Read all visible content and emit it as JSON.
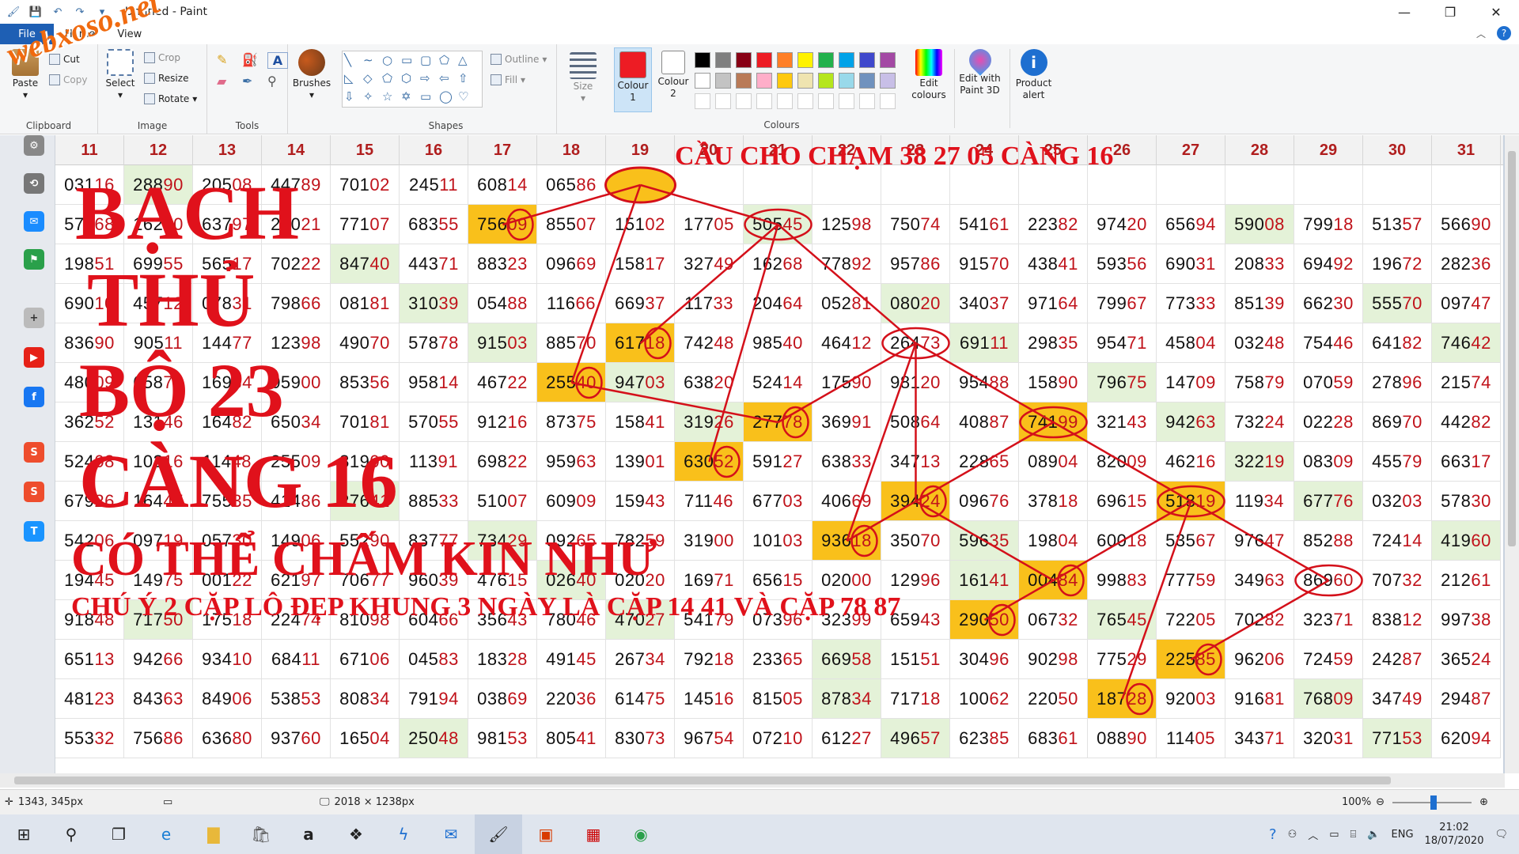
{
  "window": {
    "title": "Untitled - Paint"
  },
  "menu": {
    "file": "File",
    "tabs": [
      "Home",
      "View"
    ],
    "help": "?"
  },
  "ribbon": {
    "clipboard": {
      "label": "Clipboard",
      "paste": "Paste",
      "cut": "Cut",
      "copy": "Copy"
    },
    "image": {
      "label": "Image",
      "select": "Select",
      "crop": "Crop",
      "resize": "Resize",
      "rotate": "Rotate"
    },
    "tools": {
      "label": "Tools"
    },
    "brushes": {
      "label": "Brushes"
    },
    "shapes": {
      "label": "Shapes",
      "outline": "Outline",
      "fill": "Fill"
    },
    "size": {
      "label": "Size"
    },
    "colour1": {
      "line1": "Colour",
      "line2": "1"
    },
    "colour2": {
      "line1": "Colour",
      "line2": "2"
    },
    "colours": {
      "label": "Colours"
    },
    "edit_colours": {
      "line1": "Edit",
      "line2": "colours"
    },
    "edit_3d": {
      "line1": "Edit with",
      "line2": "Paint 3D"
    },
    "product_alert": {
      "line1": "Product",
      "line2": "alert"
    },
    "palette_row1": [
      "#000000",
      "#7f7f7f",
      "#880015",
      "#ed1c24",
      "#ff7f27",
      "#fff200",
      "#22b14c",
      "#00a2e8",
      "#3f48cc",
      "#a349a4"
    ],
    "palette_row2": [
      "#ffffff",
      "#c3c3c3",
      "#b97a57",
      "#ffaec9",
      "#ffc90e",
      "#efe4b0",
      "#b5e61d",
      "#99d9ea",
      "#7092be",
      "#c8bfe7"
    ],
    "colour1_hex": "#ed1c24",
    "colour2_hex": "#ffffff"
  },
  "watermark": "webxoso.net",
  "table": {
    "headers": [
      "11",
      "12",
      "13",
      "14",
      "15",
      "16",
      "17",
      "18",
      "19",
      "20",
      "21",
      "22",
      "23",
      "24",
      "25",
      "26",
      "27",
      "28",
      "29",
      "30",
      "31"
    ],
    "rows": [
      [
        "03116",
        "28890",
        "20508",
        "44789",
        "70102",
        "24511",
        "60814",
        "06586",
        "",
        "",
        "",
        "",
        "",
        "",
        "",
        "",
        "",
        "",
        "",
        "",
        ""
      ],
      [
        "57168",
        "16280",
        "63797",
        "22021",
        "77107",
        "68355",
        "75609",
        "85507",
        "15102",
        "17705",
        "50545",
        "12598",
        "75074",
        "54161",
        "22382",
        "97420",
        "65694",
        "59008",
        "79918",
        "51357",
        "56690"
      ],
      [
        "19851",
        "69955",
        "56517",
        "70222",
        "84740",
        "44371",
        "88323",
        "09669",
        "15817",
        "32749",
        "16268",
        "77892",
        "95786",
        "91570",
        "43841",
        "59356",
        "69031",
        "20833",
        "69492",
        "19672",
        "28236"
      ],
      [
        "69010",
        "45712",
        "07831",
        "79866",
        "08181",
        "31039",
        "05488",
        "11666",
        "66937",
        "11733",
        "20464",
        "05281",
        "08020",
        "34037",
        "97164",
        "79967",
        "77333",
        "85139",
        "66230",
        "55570",
        "09747"
      ],
      [
        "83690",
        "90511",
        "14477",
        "12398",
        "49070",
        "57878",
        "91503",
        "88570",
        "61718",
        "74248",
        "98540",
        "46412",
        "26473",
        "69111",
        "29835",
        "95471",
        "45804",
        "03248",
        "75446",
        "64182",
        "74642"
      ],
      [
        "48009",
        "65874",
        "16984",
        "05900",
        "85356",
        "95814",
        "46722",
        "25540",
        "94703",
        "63820",
        "52414",
        "17590",
        "98120",
        "95488",
        "15890",
        "79675",
        "14709",
        "75879",
        "07059",
        "27896",
        "21574"
      ],
      [
        "36252",
        "13146",
        "16482",
        "65034",
        "70181",
        "57055",
        "91216",
        "87375",
        "15841",
        "31926",
        "27778",
        "36991",
        "50864",
        "40887",
        "74199",
        "32143",
        "94263",
        "73224",
        "02228",
        "86970",
        "44282"
      ],
      [
        "52408",
        "10316",
        "11448",
        "25509",
        "81900",
        "11391",
        "69822",
        "95963",
        "13901",
        "63052",
        "59127",
        "63833",
        "34713",
        "22865",
        "08904",
        "82009",
        "46216",
        "32219",
        "08309",
        "45579",
        "66317"
      ],
      [
        "67926",
        "16447",
        "75535",
        "41486",
        "27641",
        "88533",
        "51007",
        "60909",
        "15943",
        "71146",
        "67703",
        "40669",
        "39424",
        "09676",
        "37818",
        "69615",
        "51819",
        "11934",
        "67776",
        "03203",
        "57830"
      ],
      [
        "54206",
        "09719",
        "05730",
        "14906",
        "55290",
        "83777",
        "73429",
        "09265",
        "78259",
        "31900",
        "10103",
        "93618",
        "35070",
        "59635",
        "19804",
        "60018",
        "53567",
        "97647",
        "85288",
        "72414",
        "41960"
      ],
      [
        "19445",
        "14975",
        "00122",
        "62197",
        "70677",
        "96039",
        "47615",
        "02640",
        "02020",
        "16971",
        "65615",
        "02000",
        "12996",
        "16141",
        "00484",
        "99883",
        "77759",
        "34963",
        "86960",
        "70732",
        "21261"
      ],
      [
        "91848",
        "71750",
        "17518",
        "22474",
        "81098",
        "60466",
        "35643",
        "78046",
        "47027",
        "54179",
        "07396",
        "32399",
        "65943",
        "29050",
        "06732",
        "76545",
        "72205",
        "70282",
        "32371",
        "83812",
        "99738"
      ],
      [
        "65113",
        "94266",
        "93410",
        "68411",
        "67106",
        "04583",
        "18328",
        "49145",
        "26734",
        "79218",
        "23365",
        "66958",
        "15151",
        "30496",
        "90298",
        "77529",
        "22585",
        "96206",
        "72459",
        "24287",
        "36524"
      ],
      [
        "48123",
        "84363",
        "84906",
        "53853",
        "80834",
        "79194",
        "03869",
        "22036",
        "61475",
        "14516",
        "81505",
        "87834",
        "71718",
        "10062",
        "22050",
        "18728",
        "92003",
        "91681",
        "76809",
        "34749",
        "29487"
      ],
      [
        "55332",
        "75686",
        "63680",
        "93760",
        "16504",
        "25048",
        "98153",
        "80541",
        "83073",
        "96754",
        "07210",
        "61227",
        "49657",
        "62385",
        "68361",
        "08890",
        "11405",
        "34371",
        "32031",
        "77153",
        "62094"
      ]
    ]
  },
  "overlay": {
    "line1": "BẠCH",
    "line2": "THỦ",
    "line3": "BỘ 23",
    "line4": "CÀNG 16",
    "line5": "CÓ THỂ CHẤM KIN NHƯ",
    "banner": "CẦU CHO CHẠM 38 27 05 CÀNG 16",
    "note": "CHÚ Ý 2 CẶP LÔ ĐẸP KHUNG 3 NGÀY LÀ CẶP 14 41 VÀ CẶP 78 87"
  },
  "status": {
    "cursor": "1343, 345px",
    "size": "2018 × 1238px",
    "zoom": "100%"
  },
  "taskbar": {
    "lang": "ENG",
    "time": "21:02",
    "date": "18/07/2020"
  }
}
